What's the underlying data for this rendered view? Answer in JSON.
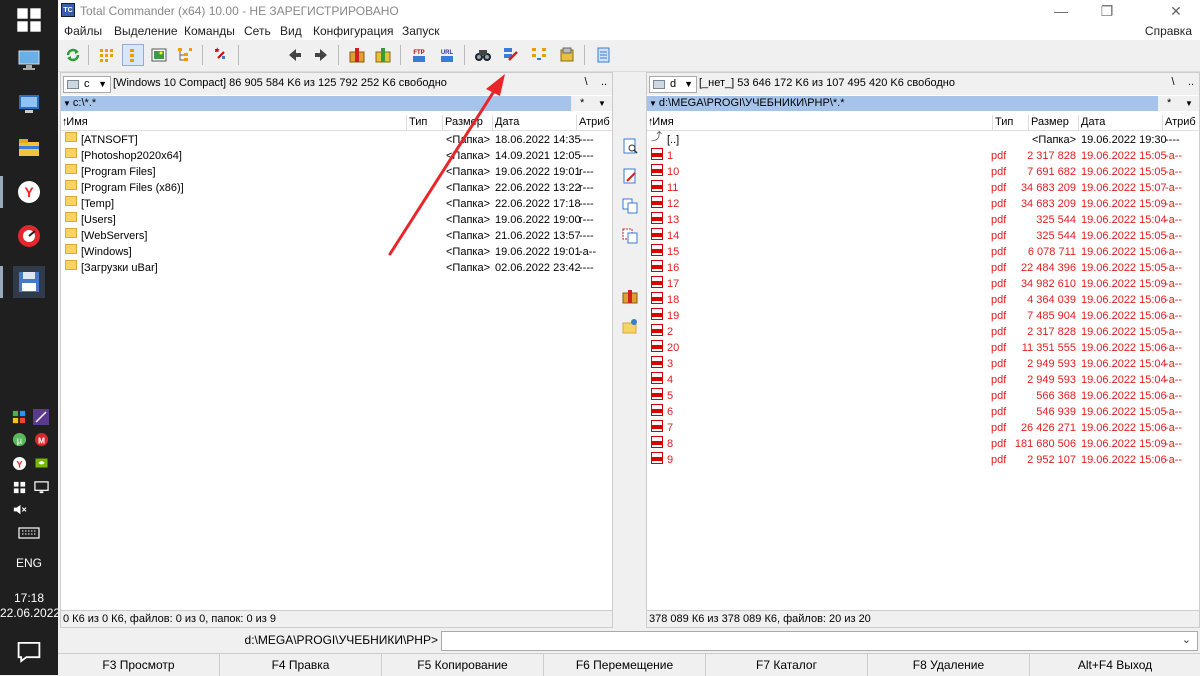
{
  "window": {
    "title": "Total Commander (x64) 10.00 - НЕ ЗАРЕГИСТРИРОВАНО",
    "icon_text": "TC",
    "controls": [
      "minimize-icon",
      "restore-icon",
      "close-icon"
    ]
  },
  "menu": {
    "items": [
      "Файлы",
      "Выделение",
      "Команды",
      "Сеть",
      "Вид",
      "Конфигурация",
      "Запуск"
    ],
    "help": "Справка"
  },
  "taskbar": {
    "apps": [
      "start-icon",
      "computer-icon",
      "remote-desktop-icon",
      "file-explorer-icon",
      "yandex-browser-icon",
      "speedometer-icon",
      "floppy-icon"
    ],
    "tray": [
      "shield-icon",
      "feather-icon",
      "utorrent-icon",
      "mega-icon",
      "yandex-icon",
      "nvidia-icon",
      "network-icon",
      "display-icon",
      "volume-muted-icon",
      "keyboard-icon"
    ],
    "lang": "ENG",
    "time": "17:18",
    "date": "22.06.2022",
    "notification": "notification-icon"
  },
  "toolbar": {
    "buttons": [
      "refresh-icon",
      "brief-view-icon",
      "full-view-icon",
      "thumbnails-icon",
      "tree-icon",
      "invert-selection-icon",
      "unpack-icon",
      "back-icon",
      "forward-icon",
      "pack-icon",
      "unpack-files-icon",
      "ftp-icon",
      "url-icon",
      "find-files-icon",
      "multi-rename-icon",
      "sync-dirs-icon",
      "copy-names-icon",
      "notepad-icon"
    ],
    "ftp_label": "FTP",
    "url_label": "URL"
  },
  "left_panel": {
    "drive": "c",
    "drive_info": "[Windows 10 Compact]  86 905 584 K6 из 125 792 252 K6 свободно",
    "root_btn": "\\",
    "up_btn": "..",
    "path": "c:\\*.*",
    "filter": "*",
    "headers": {
      "name": "Имя",
      "type": "Тип",
      "size": "Размер",
      "date": "Дата",
      "attr": "Атриб"
    },
    "files": [
      {
        "name": "[ATNSOFT]",
        "size": "<Папка>",
        "date": "18.06.2022 14:35",
        "attr": "----"
      },
      {
        "name": "[Photoshop2020x64]",
        "size": "<Папка>",
        "date": "14.09.2021 12:05",
        "attr": "----"
      },
      {
        "name": "[Program Files]",
        "size": "<Папка>",
        "date": "19.06.2022 19:01",
        "attr": "r---"
      },
      {
        "name": "[Program Files (x86)]",
        "size": "<Папка>",
        "date": "22.06.2022 13:22",
        "attr": "r---"
      },
      {
        "name": "[Temp]",
        "size": "<Папка>",
        "date": "22.06.2022 17:18",
        "attr": "----"
      },
      {
        "name": "[Users]",
        "size": "<Папка>",
        "date": "19.06.2022 19:00",
        "attr": "r---"
      },
      {
        "name": "[WebServers]",
        "size": "<Папка>",
        "date": "21.06.2022 13:57",
        "attr": "----"
      },
      {
        "name": "[Windows]",
        "size": "<Папка>",
        "date": "19.06.2022 19:01",
        "attr": "-a--"
      },
      {
        "name": "[Загрузки uBar]",
        "size": "<Папка>",
        "date": "02.06.2022 23:42",
        "attr": "----"
      }
    ],
    "status": "0 К6 из 0 К6, файлов: 0 из 0, папок: 0 из 9"
  },
  "right_panel": {
    "drive": "d",
    "drive_info": "[_нет_]  53 646 172 K6 из 107 495 420 K6 свободно",
    "root_btn": "\\",
    "up_btn": "..",
    "path": "d:\\MEGA\\PROGI\\УЧЕБНИКИ\\PHP\\*.*",
    "filter": "*",
    "headers": {
      "name": "Имя",
      "type": "Тип",
      "size": "Размер",
      "date": "Дата",
      "attr": "Атриб"
    },
    "parent": {
      "name": "[..]",
      "size": "<Папка>",
      "date": "19.06.2022 19:30",
      "attr": "----"
    },
    "files": [
      {
        "name": "1",
        "ext": "pdf",
        "size": "2 317 828",
        "date": "19.06.2022 15:05",
        "attr": "-a--"
      },
      {
        "name": "10",
        "ext": "pdf",
        "size": "7 691 682",
        "date": "19.06.2022 15:05",
        "attr": "-a--"
      },
      {
        "name": "11",
        "ext": "pdf",
        "size": "34 683 209",
        "date": "19.06.2022 15:07",
        "attr": "-a--"
      },
      {
        "name": "12",
        "ext": "pdf",
        "size": "34 683 209",
        "date": "19.06.2022 15:09",
        "attr": "-a--"
      },
      {
        "name": "13",
        "ext": "pdf",
        "size": "325 544",
        "date": "19.06.2022 15:04",
        "attr": "-a--"
      },
      {
        "name": "14",
        "ext": "pdf",
        "size": "325 544",
        "date": "19.06.2022 15:05",
        "attr": "-a--"
      },
      {
        "name": "15",
        "ext": "pdf",
        "size": "6 078 711",
        "date": "19.06.2022 15:06",
        "attr": "-a--"
      },
      {
        "name": "16",
        "ext": "pdf",
        "size": "22 484 396",
        "date": "19.06.2022 15:05",
        "attr": "-a--"
      },
      {
        "name": "17",
        "ext": "pdf",
        "size": "34 982 610",
        "date": "19.06.2022 15:09",
        "attr": "-a--"
      },
      {
        "name": "18",
        "ext": "pdf",
        "size": "4 364 039",
        "date": "19.06.2022 15:06",
        "attr": "-a--"
      },
      {
        "name": "19",
        "ext": "pdf",
        "size": "7 485 904",
        "date": "19.06.2022 15:06",
        "attr": "-a--"
      },
      {
        "name": "2",
        "ext": "pdf",
        "size": "2 317 828",
        "date": "19.06.2022 15:05",
        "attr": "-a--"
      },
      {
        "name": "20",
        "ext": "pdf",
        "size": "11 351 555",
        "date": "19.06.2022 15:06",
        "attr": "-a--"
      },
      {
        "name": "3",
        "ext": "pdf",
        "size": "2 949 593",
        "date": "19.06.2022 15:04",
        "attr": "-a--"
      },
      {
        "name": "4",
        "ext": "pdf",
        "size": "2 949 593",
        "date": "19.06.2022 15:04",
        "attr": "-a--"
      },
      {
        "name": "5",
        "ext": "pdf",
        "size": "566 368",
        "date": "19.06.2022 15:06",
        "attr": "-a--"
      },
      {
        "name": "6",
        "ext": "pdf",
        "size": "546 939",
        "date": "19.06.2022 15:05",
        "attr": "-a--"
      },
      {
        "name": "7",
        "ext": "pdf",
        "size": "26 426 271",
        "date": "19.06.2022 15:06",
        "attr": "-a--"
      },
      {
        "name": "8",
        "ext": "pdf",
        "size": "181 680 506",
        "date": "19.06.2022 15:09",
        "attr": "-a--"
      },
      {
        "name": "9",
        "ext": "pdf",
        "size": "2 952 107",
        "date": "19.06.2022 15:06",
        "attr": "-a--"
      }
    ],
    "status": "378 089 К6 из 378 089 К6, файлов: 20 из 20"
  },
  "middle_buttons": [
    "view-icon",
    "edit-icon",
    "copy-icon",
    "move-icon",
    "pack-icon",
    "new-folder-icon"
  ],
  "command_line": {
    "path": "d:\\MEGA\\PROGI\\УЧЕБНИКИ\\PHP>",
    "value": ""
  },
  "fkeys": [
    "F3 Просмотр",
    "F4 Правка",
    "F5 Копирование",
    "F6 Перемещение",
    "F7 Каталог",
    "F8 Удаление",
    "Alt+F4 Выход"
  ],
  "colors": {
    "path_highlight": "#a6c4ea",
    "pdf_text": "#e02020",
    "annotation_arrow": "#e8262a",
    "taskbar": "#1f1f1f"
  }
}
